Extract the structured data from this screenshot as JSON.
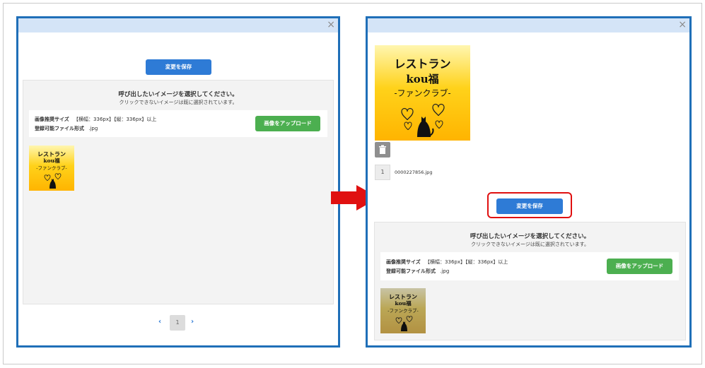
{
  "colors": {
    "dialog_border": "#1f6fb8",
    "header_bg": "#d4e4f7",
    "primary": "#2e7bd6",
    "success": "#4caf50",
    "highlight": "#e01010",
    "arrow": "#e01010"
  },
  "left_dialog": {
    "close_icon": "×",
    "save_button": "変更を保存",
    "panel": {
      "title": "呼び出したいイメージを選択してください。",
      "subtitle": "クリックできないイメージは既に選択されています。",
      "size_label": "画像推奨サイズ",
      "size_value": "【横幅：336px】【縦：336px】以上",
      "format_label": "登録可能ファイル形式",
      "format_value": ".jpg",
      "upload_button": "画像をアップロード",
      "thumbnail": {
        "line1": "レストラン",
        "line2": "kou福",
        "line3": "-ファンクラブ-",
        "icon": "cat-hearts-icon"
      }
    },
    "pagination": {
      "prev": "‹",
      "current": "1",
      "next": "›"
    }
  },
  "right_dialog": {
    "close_icon": "×",
    "selected_image": {
      "line1": "レストラン",
      "line2": "kou福",
      "line3": "-ファンクラブ-",
      "icon": "cat-hearts-icon"
    },
    "trash_icon": "trash-icon",
    "selected_index": "1",
    "selected_filename": "0000227856.jpg",
    "save_button": "変更を保存",
    "panel": {
      "title": "呼び出したいイメージを選択してください。",
      "subtitle": "クリックできないイメージは既に選択されています。",
      "size_label": "画像推奨サイズ",
      "size_value": "【横幅：336px】【縦：336px】以上",
      "format_label": "登録可能ファイル形式",
      "format_value": ".jpg",
      "upload_button": "画像をアップロード",
      "thumbnail": {
        "line1": "レストラン",
        "line2": "kou福",
        "line3": "-ファンクラブ-",
        "icon": "cat-hearts-icon"
      }
    }
  },
  "arrow_icon": "right-arrow-icon"
}
